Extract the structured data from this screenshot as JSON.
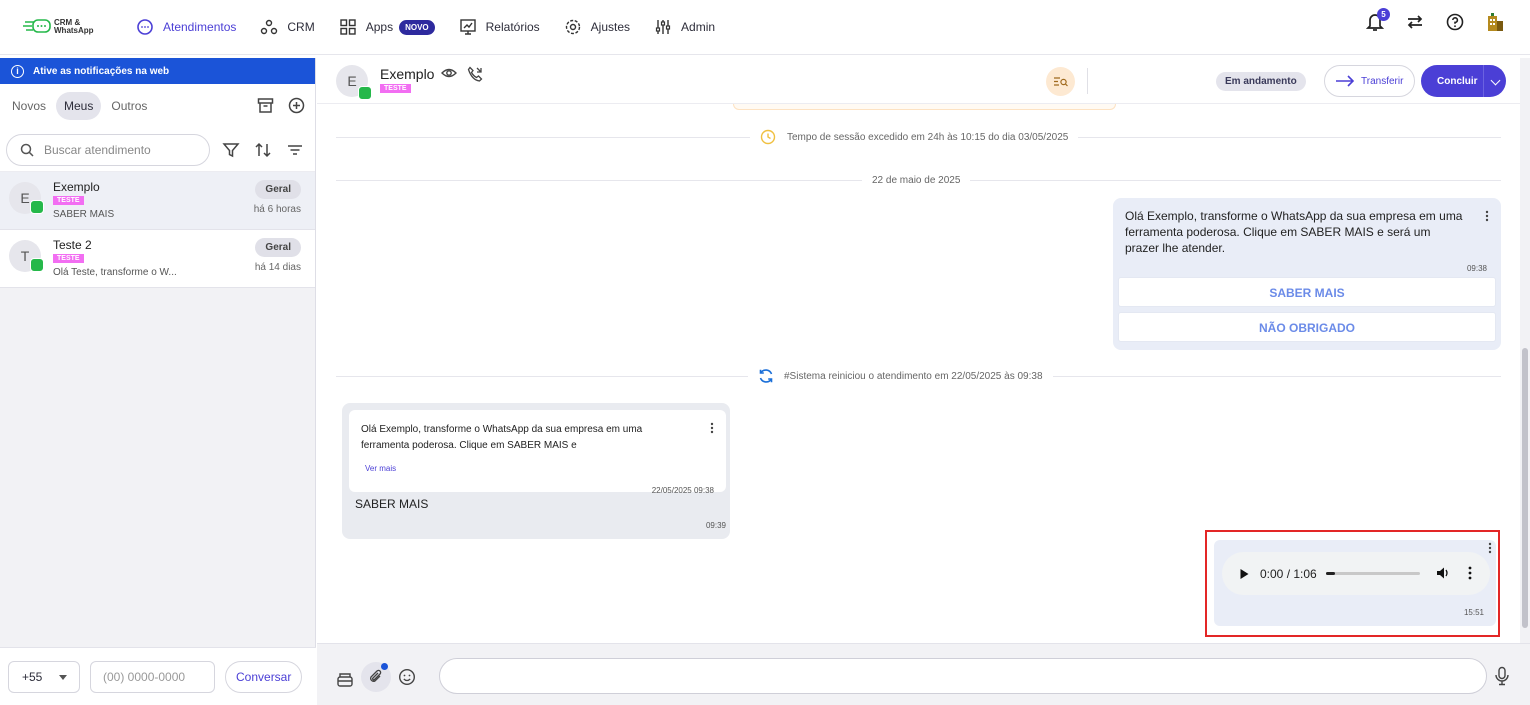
{
  "brand": {
    "line1": "CRM &",
    "line2": "WhatsApp"
  },
  "nav": {
    "items": [
      {
        "label": "Atendimentos"
      },
      {
        "label": "CRM"
      },
      {
        "label": "Apps"
      },
      {
        "label": "Relatórios"
      },
      {
        "label": "Ajustes"
      },
      {
        "label": "Admin"
      }
    ],
    "apps_badge": "NOVO",
    "notif_count": "5"
  },
  "sidebar": {
    "notif_banner": "Ative as notificações na web",
    "tabs": [
      "Novos",
      "Meus",
      "Outros"
    ],
    "search_placeholder": "Buscar atendimento",
    "conversations": [
      {
        "initial": "E",
        "name": "Exemplo",
        "tag": "TESTE",
        "preview": "SABER MAIS",
        "queue": "Geral",
        "time": "há 6 horas"
      },
      {
        "initial": "T",
        "name": "Teste 2",
        "tag": "TESTE",
        "preview": "Olá Teste, transforme o W...",
        "queue": "Geral",
        "time": "há 14 dias"
      }
    ],
    "ddi": "+55",
    "phone_placeholder": "(00) 0000-0000",
    "conversar_label": "Conversar"
  },
  "chat": {
    "contact_initial": "E",
    "contact_name": "Exemplo",
    "contact_tag": "TESTE",
    "status": "Em andamento",
    "transfer_label": "Transferir",
    "conclude_label": "Concluir",
    "session_notice": "Tempo de sessão excedido em 24h às 10:15 do dia 03/05/2025",
    "date_divider": "22 de maio de 2025",
    "outgoing_template": {
      "text": "Olá Exemplo, transforme o WhatsApp da sua empresa em uma ferramenta poderosa. Clique em SABER MAIS e será um prazer lhe atender.",
      "time": "09:38",
      "buttons": [
        "SABER MAIS",
        "NÃO OBRIGADO"
      ]
    },
    "system_restart": "#Sistema reiniciou o atendimento em 22/05/2025 às 09:38",
    "incoming_reply": {
      "quoted_text": "Olá Exemplo, transforme o WhatsApp da sua empresa em uma ferramenta poderosa. Clique em SABER MAIS e",
      "quoted_more": "Ver mais",
      "quoted_time": "22/05/2025 09:38",
      "body": "SABER MAIS",
      "time": "09:39"
    },
    "audio_message": {
      "player_time": "0:00 / 1:06",
      "progress": 0.1,
      "time": "15:51"
    }
  },
  "colors": {
    "accent": "#4b3fd6",
    "banner": "#1b54d8",
    "tag": "#f26ef2",
    "whatsapp": "#25b84a",
    "highlight_frame": "#e32626"
  }
}
